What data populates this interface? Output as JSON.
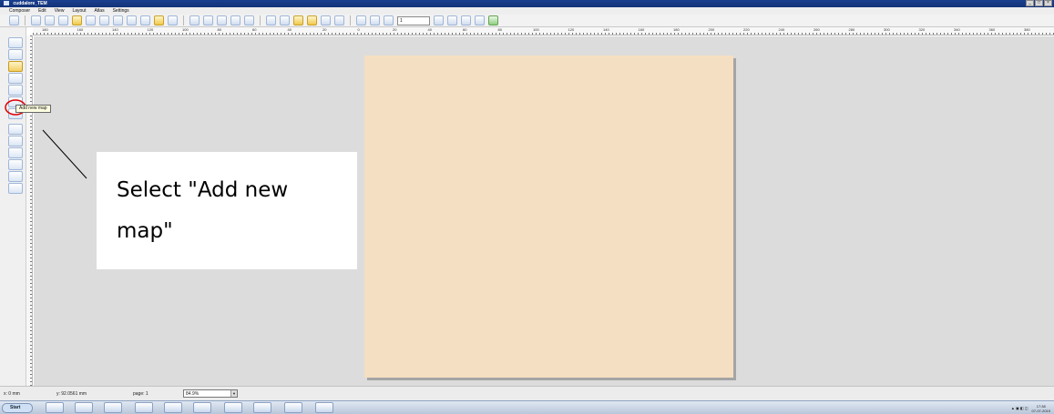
{
  "window": {
    "title": "cuddalore_TEM",
    "controls": [
      "_",
      "□",
      "×"
    ]
  },
  "menu": [
    "Composer",
    "Edit",
    "View",
    "Layout",
    "Atlas",
    "Settings"
  ],
  "toolbar": {
    "page_value": "1"
  },
  "ruler_labels": [
    "180",
    "160",
    "140",
    "120",
    "100",
    "80",
    "60",
    "40",
    "20",
    "0",
    "20",
    "40",
    "60",
    "80",
    "100",
    "120",
    "140",
    "160",
    "180",
    "200",
    "220",
    "240",
    "260",
    "280",
    "300",
    "320",
    "340",
    "360",
    "380"
  ],
  "tooltip": "Add new map",
  "callout": {
    "line1": "Select \"Add new",
    "line2": "map\""
  },
  "status": {
    "x": "x: 0 mm",
    "y": "y: 92.0561 mm",
    "page": "page: 1",
    "zoom": "84.9%"
  },
  "taskbar": {
    "start_label": "Start",
    "time": "17:38",
    "date": "07-07-2019"
  },
  "colors": {
    "paper": "#f5dfc2",
    "canvas": "#dcdcdc",
    "annotation": "#e00000"
  }
}
